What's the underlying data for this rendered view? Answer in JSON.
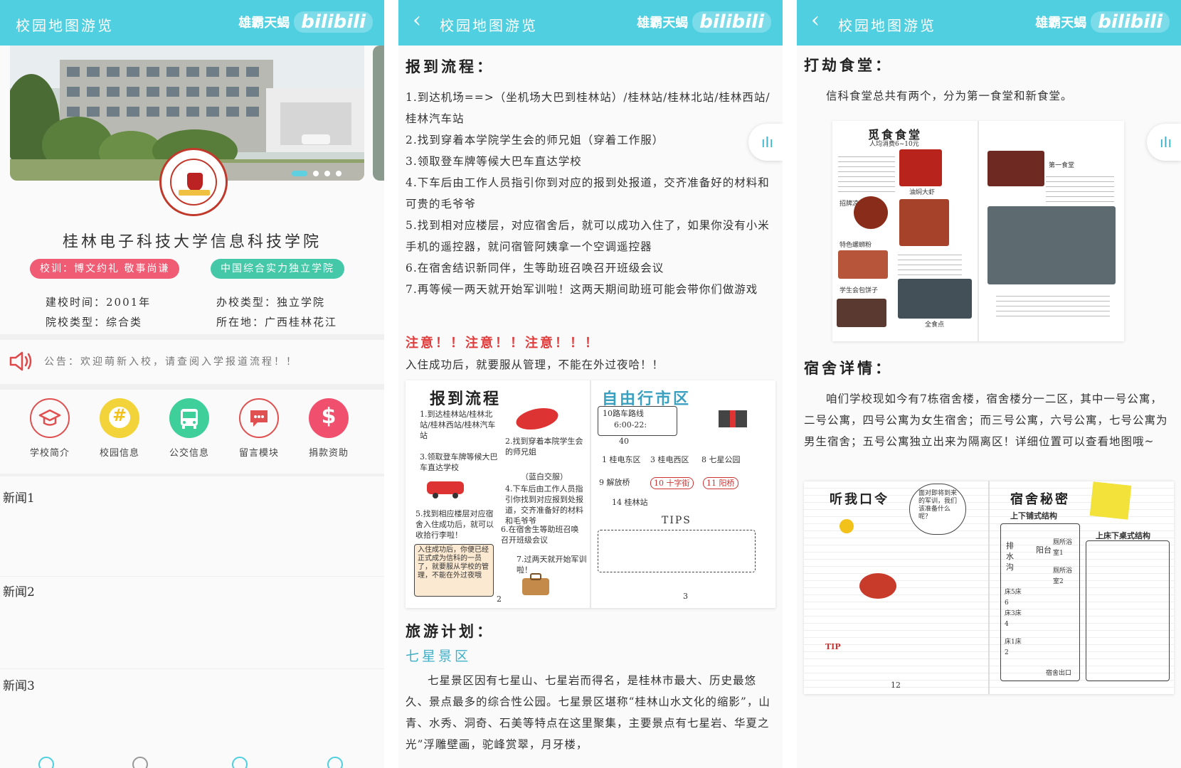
{
  "watermark": {
    "text": "雄霸天蝎",
    "logo": "bilibili"
  },
  "colors": {
    "accent": "#4fcfe0",
    "red_tag": "#ef5c74",
    "green_tag": "#45c8a8",
    "warn": "#e03c3c",
    "subhead": "#3fb0c8"
  },
  "panel1": {
    "title": "校园地图游览",
    "school_name": "桂林电子科技大学信息科技学院",
    "motto_tag": "校训：博文约礼 敬事尚谦",
    "rank_tag": "中国综合实力独立学院",
    "info": {
      "founded": "建校时间：2001年",
      "school_type": "办校类型：独立学院",
      "category": "院校类型：综合类",
      "location": "所在地：广西桂林花江"
    },
    "notice": "公告：欢迎萌新入校，请查阅入学报道流程！！",
    "grid": [
      {
        "label": "学校简介",
        "icon": "graduation-cap-icon"
      },
      {
        "label": "校园信息",
        "icon": "hash-icon"
      },
      {
        "label": "公交信息",
        "icon": "bus-icon"
      },
      {
        "label": "留言模块",
        "icon": "message-icon"
      },
      {
        "label": "捐款资助",
        "icon": "dollar-icon"
      }
    ],
    "news": [
      "新闻1",
      "新闻2",
      "新闻3"
    ]
  },
  "panel2": {
    "title": "校园地图游览",
    "heading1": "报到流程：",
    "steps_text": "1.到达机场==>（坐机场大巴到桂林站）/桂林站/桂林北站/桂林西站/桂林汽车站\n2.找到穿着本学院学生会的师兄姐（穿着工作服）\n3.领取登车牌等候大巴车直达学校\n4.下车后由工作人员指引你到对应的报到处报道，交齐准备好的材料和可贵的毛爷爷\n5.找到相对应楼层，对应宿舍后，就可以成功入住了，如果你没有小米手机的遥控器，就问宿管阿姨拿一个空调遥控器\n6.在宿舍结识新同伴，生等助班召唤召开班级会议\n7.再等候一两天就开始军训啦！这两天期间助班可能会带你们做游戏",
    "warning": "注意！！注意！！注意！！！",
    "warning_text": "入住成功后，就要服从管理，不能在外过夜哈！！",
    "spread_left": {
      "title": "报到流程",
      "notes": [
        "1.到达桂林站/桂林北站/桂林西站/桂林汽车站",
        "2.找到穿着本院学生会的师兄姐",
        "3.领取登车牌等候大巴车直达学校",
        "（蓝白交服）",
        "4.下车后由工作人员指引你找到对应报到处报道，交齐准备好的材料和毛爷爷",
        "5.找到相应楼层对应宿舍入住成功后，就可以收拾行李啦！",
        "6.在宿舍生等助班召唤召开班级会议",
        "7.过两天就开始军训啦！",
        "入住成功后，你便已经正式成为信科的一员了，就要服从学校的管理，不能在外过夜哦",
        "2"
      ]
    },
    "spread_right": {
      "title": "自由行市区",
      "notes": [
        "10路车路线",
        "6:00-22:",
        "40",
        "1 桂电东区",
        "3 桂电西区",
        "8 七星公园",
        "9 解放桥",
        "10 十字街",
        "11 阳桥",
        "14 桂林站",
        "TIPS",
        "3"
      ]
    },
    "heading2": "旅游计划：",
    "subheading": "七星景区",
    "travel_text": "七星景区因有七星山、七星岩而得名，是桂林市最大、历史最悠久、景点最多的综合性公园。七星景区堪称“桂林山水文化的缩影”，山青、水秀、洞奇、石美等特点在这里聚集，主要景点有七星岩、华夏之光”浮雕壁画，驼峰赏翠，月牙楼，"
  },
  "panel3": {
    "title": "校园地图游览",
    "heading1": "打劫食堂：",
    "canteen_text": "信科食堂总共有两个，分为第一食堂和新食堂。",
    "spread1": {
      "title": "觅食食堂",
      "notes": [
        "人均消费6~10元",
        "油焖大虾",
        "招牌凉面",
        "特色螺蛳粉",
        "学生会包饼子",
        "全食点",
        "第一食堂"
      ]
    },
    "heading2": "宿舍详情：",
    "dorm_text": "咱们学校现如今有7栋宿舍楼，宿舍楼分一二区，其中一号公寓，二号公寓，四号公寓为女生宿舍；而三号公寓，六号公寓，七号公寓为男生宿舍；五号公寓独立出来为隔离区！详细位置可以查看地图哦~",
    "spread2": {
      "left_title": "听我口令",
      "bubble": "面对即将到来的军训，我们该准备什么呢？",
      "notes": [
        "TIP",
        "12"
      ],
      "right_title": "宿舍秘密",
      "labels": [
        "上下铺式结构",
        "上床下桌式结构",
        "阳台",
        "排水沟",
        "厕所浴室1",
        "厕所浴室2",
        "床3床4",
        "床5床6",
        "床1床2",
        "宿舍出口"
      ]
    }
  }
}
